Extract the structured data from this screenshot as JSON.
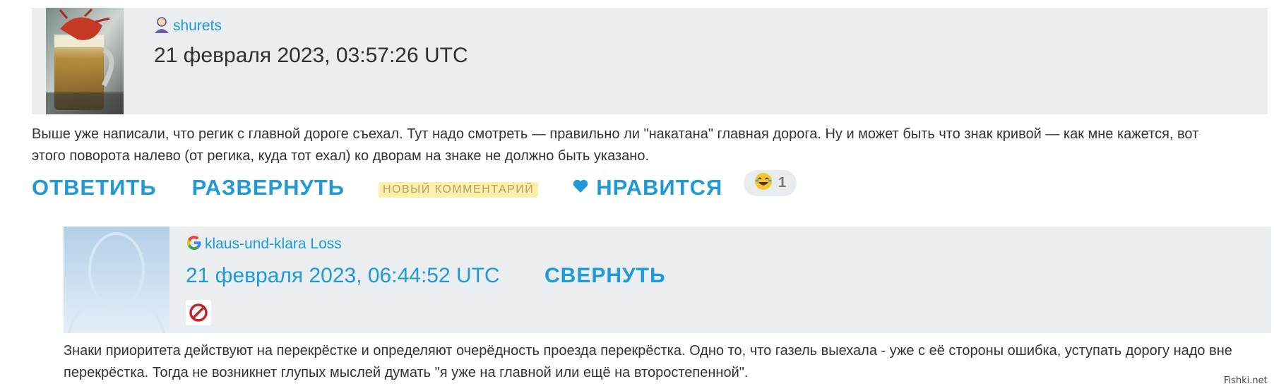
{
  "comments": [
    {
      "username": "shurets",
      "date": "21 февраля 2023, 03:57:26 UTC",
      "text": "Выше уже написали, что регик с главной дороге съехал. Тут надо смотреть — правильно ли \"накатана\" главная дорога. Ну и может быть что знак кривой — как мне кажется, вот этого поворота налево (от регика, куда тот ехал) ко дворам на знаке не должно быть указано.",
      "actions": {
        "reply": "ОТВЕТИТЬ",
        "expand": "РАЗВЕРНУТЬ",
        "new_badge": "НОВЫЙ КОММЕНТАРИЙ",
        "like": "НРАВИТСЯ"
      },
      "reaction_count": "1"
    },
    {
      "username": "klaus-und-klara Loss",
      "date": "21 февраля 2023, 06:44:52 UTC",
      "collapse": "СВЕРНУТЬ",
      "text": "Знаки приоритета действуют на перекрёстке и определяют очерёдность проезда перекрёстка. Одно то, что газель выехала - уже с её стороны ошибка, уступать дорогу надо вне перекрёстка. Тогда не возникнет глупых мыслей думать \"я уже на главной или ещё на второстепенной\"."
    }
  ],
  "watermark": "Fishki.net",
  "colors": {
    "accent": "#1f9ad6",
    "header_bg": "#eaeef0",
    "badge_bg": "#fbefaa",
    "block_red": "#c0262b"
  },
  "icons": [
    "user-icon",
    "google-icon",
    "heart-icon",
    "laughing-emoji-icon",
    "block-icon"
  ]
}
